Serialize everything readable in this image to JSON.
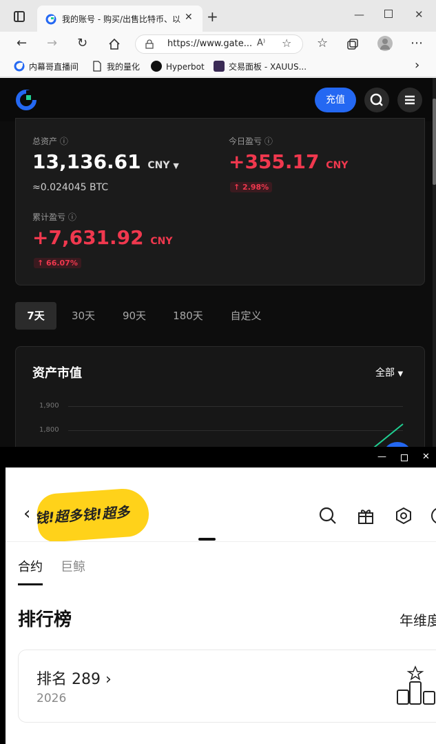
{
  "browser": {
    "tab_title": "我的账号 - 购买/出售比特币、以",
    "new_tab": "+",
    "url": "https://www.gate...",
    "read_aloud": "A⁾",
    "bookmarks": [
      {
        "label": "内幕哥直播间"
      },
      {
        "label": "我的量化"
      },
      {
        "label": "Hyperbot"
      },
      {
        "label": "交易面板 - XAUUS..."
      }
    ],
    "bookmarks_more": "›"
  },
  "site": {
    "deposit_label": "充值",
    "accent": "#2468f2",
    "up_color": "#f0384e"
  },
  "assets": {
    "total_label": "总资产",
    "total_value": "13,136.61",
    "total_unit": "CNY",
    "total_btc": "≈0.024045 BTC",
    "today_label": "今日盈亏",
    "today_value": "+355.17",
    "today_unit": "CNY",
    "today_pct": "↑ 2.98%",
    "cum_label": "累计盈亏",
    "cum_value": "+7,631.92",
    "cum_unit": "CNY",
    "cum_pct": "↑ 66.07%"
  },
  "periods": [
    "7天",
    "30天",
    "90天",
    "180天",
    "自定义"
  ],
  "market_value": {
    "title": "资产市值",
    "filter": "全部",
    "y_ticks": [
      "1,900",
      "1,800"
    ]
  },
  "app2": {
    "banner_text": "钱!超多钱!超多",
    "tabs": [
      "合约",
      "巨鲸"
    ],
    "section_title": "排行榜",
    "section_right": "年维度",
    "rank_label": "排名 289",
    "rank_year": "2026"
  }
}
